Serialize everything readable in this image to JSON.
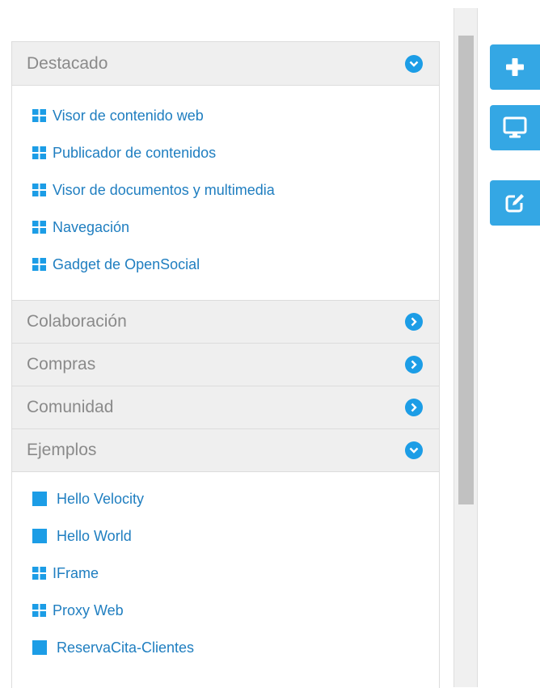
{
  "categories": [
    {
      "title": "Destacado",
      "expanded": true,
      "items": [
        {
          "label": "Visor de contenido web",
          "icon": "grid-icon"
        },
        {
          "label": "Publicador de contenidos",
          "icon": "grid-icon"
        },
        {
          "label": "Visor de documentos y multimedia",
          "icon": "grid-icon"
        },
        {
          "label": "Navegación",
          "icon": "grid-icon"
        },
        {
          "label": "Gadget de OpenSocial",
          "icon": "grid-icon"
        }
      ]
    },
    {
      "title": "Colaboración",
      "expanded": false
    },
    {
      "title": "Compras",
      "expanded": false
    },
    {
      "title": "Comunidad",
      "expanded": false
    },
    {
      "title": "Ejemplos",
      "expanded": true,
      "items": [
        {
          "label": "Hello Velocity",
          "icon": "square-icon"
        },
        {
          "label": "Hello World",
          "icon": "square-icon"
        },
        {
          "label": "IFrame",
          "icon": "grid-icon"
        },
        {
          "label": "Proxy Web",
          "icon": "grid-icon"
        },
        {
          "label": "ReservaCita-Clientes",
          "icon": "square-icon"
        }
      ]
    }
  ],
  "toolbar": [
    {
      "name": "add-button",
      "icon": "plus-icon"
    },
    {
      "name": "preview-button",
      "icon": "monitor-icon"
    },
    {
      "name": "edit-button",
      "icon": "edit-icon"
    }
  ],
  "colors": {
    "accent": "#1c9de6",
    "toolbar": "#34a7e4",
    "link": "#1f7ec0",
    "header_bg": "#efefef",
    "header_text": "#8a8a8a"
  }
}
